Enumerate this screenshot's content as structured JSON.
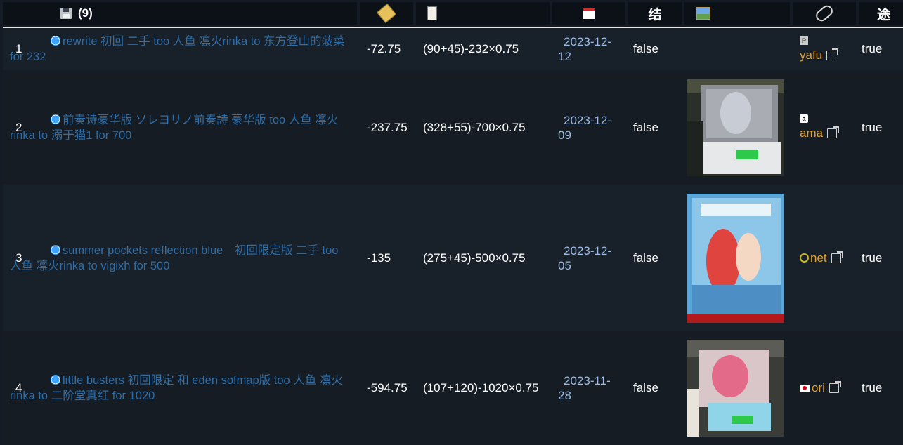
{
  "header": {
    "count": "(9)",
    "col_settled": "结",
    "col_in_use": "途"
  },
  "rows": [
    {
      "no": "1",
      "title": "rewrite 初回 二手 too 人鱼 凛火rinka to 东方登山的菠菜 for 232",
      "profit": "-72.75",
      "formula": "(90+45)-232×0.75",
      "date_a": "2023-12-",
      "date_b": "12",
      "settled": "false",
      "has_image": false,
      "source_badge": "P",
      "source": "yafu",
      "in_use": "true"
    },
    {
      "no": "2",
      "title": "前奏诗豪华版 ソレヨリノ前奏詩 豪华版 too 人鱼 凛火 rinka to 溺于猫1 for 700",
      "profit": "-237.75",
      "formula": "(328+55)-700×0.75",
      "date_a": "2023-12-",
      "date_b": "09",
      "settled": "false",
      "has_image": true,
      "source_badge": "a",
      "source": "ama",
      "in_use": "true"
    },
    {
      "no": "3",
      "title": "summer pockets reflection blue　初回限定版 二手 too 人鱼 凛火rinka to vigixh for 500",
      "profit": "-135",
      "formula": "(275+45)-500×0.75",
      "date_a": "2023-12-",
      "date_b": "05",
      "settled": "false",
      "has_image": true,
      "source_badge": "",
      "source": "net",
      "in_use": "true"
    },
    {
      "no": "4",
      "title": "little busters 初回限定 和 eden sofmap版 too 人鱼 凛火 rinka to 二阶堂真红 for 1020",
      "profit": "-594.75",
      "formula": "(107+120)-1020×0.75",
      "date_a": "2023-11-",
      "date_b": "28",
      "settled": "false",
      "has_image": true,
      "source_badge": "",
      "source": "ori",
      "in_use": "true"
    }
  ]
}
